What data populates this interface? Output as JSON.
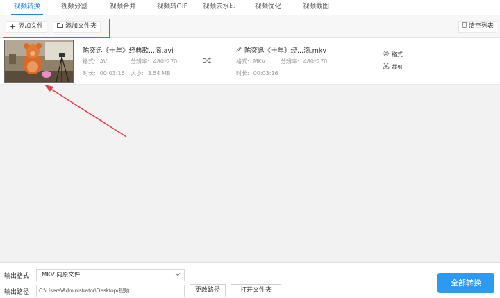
{
  "tabs": [
    {
      "label": "视频转换",
      "active": true
    },
    {
      "label": "视频分割",
      "active": false
    },
    {
      "label": "视频合并",
      "active": false
    },
    {
      "label": "视频转GIF",
      "active": false
    },
    {
      "label": "视频去水印",
      "active": false
    },
    {
      "label": "视频优化",
      "active": false
    },
    {
      "label": "视频截图",
      "active": false
    }
  ],
  "toolbar": {
    "add_file": "添加文件",
    "add_folder": "添加文件夹",
    "clear_list": "清空列表"
  },
  "file": {
    "source": {
      "name": "陈奕迅《十年》经典歌...滴.avi",
      "format_label": "格式:",
      "format": "AVI",
      "resolution_label": "分辨率:",
      "resolution": "480*270",
      "duration_label": "时长:",
      "duration": "00:03:16",
      "size_label": "大小:",
      "size": "3.54 MB"
    },
    "target": {
      "name": "陈奕迅《十年》经...滴.mkv",
      "format_label": "格式:",
      "format": "MKV",
      "resolution_label": "分辨率:",
      "resolution": "480*270",
      "duration_label": "时长:",
      "duration": "00:03:16"
    },
    "actions": {
      "format": "格式",
      "trim": "裁剪"
    }
  },
  "output": {
    "format_label": "输出格式",
    "format_value": "MKV  同原文件",
    "path_label": "输出路径",
    "path_value": "C:\\Users\\Administrator\\Desktop\\视频",
    "change_path": "更改路径",
    "open_folder": "打开文件夹",
    "convert_all": "全部转换"
  },
  "colors": {
    "accent": "#1f86e6",
    "highlight": "#e0404a",
    "convert_button": "#2d9af0"
  }
}
